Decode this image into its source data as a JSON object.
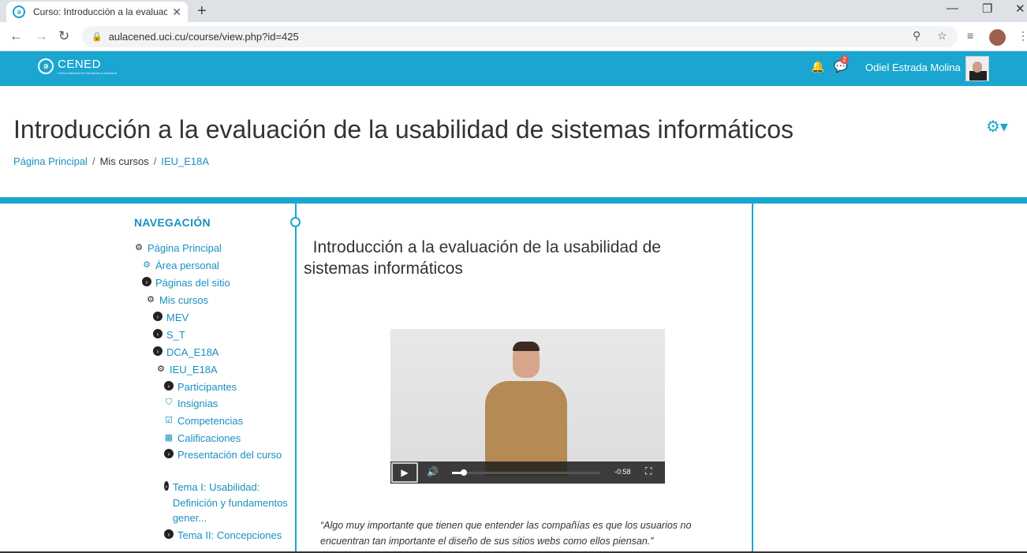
{
  "browser": {
    "tab_title": "Curso: Introducción a la evaluació",
    "url": "aulacened.uci.cu/course/view.php?id=425"
  },
  "header": {
    "logo_text": "CENED",
    "logo_sub": "Centro Nacional de Educación a Distancia",
    "notification_count": "2",
    "user_name": "Odiel Estrada Molina"
  },
  "page": {
    "title": "Introducción a la evaluación de la usabilidad de sistemas informáticos",
    "breadcrumb": [
      "Página Principal",
      "Mis cursos",
      "IEU_E18A"
    ]
  },
  "nav": {
    "heading": "NAVEGACIÓN",
    "items": [
      {
        "label": "Página Principal",
        "icon": "dashboard-icon"
      },
      {
        "label": "Área personal",
        "icon": "dashboard-icon"
      },
      {
        "label": "Páginas del sitio",
        "icon": "chevron-circle-icon"
      },
      {
        "label": "Mis cursos",
        "icon": "dashboard-icon"
      },
      {
        "label": "MEV",
        "icon": "chevron-circle-icon"
      },
      {
        "label": "S_T",
        "icon": "chevron-circle-icon"
      },
      {
        "label": "DCA_E18A",
        "icon": "chevron-circle-icon"
      },
      {
        "label": "IEU_E18A",
        "icon": "dashboard-icon"
      },
      {
        "label": "Participantes",
        "icon": "chevron-circle-icon"
      },
      {
        "label": "Insignias",
        "icon": "shield-icon"
      },
      {
        "label": "Competencias",
        "icon": "checkbox-icon"
      },
      {
        "label": "Calificaciones",
        "icon": "table-icon"
      },
      {
        "label": "Presentación del curso",
        "icon": "chevron-circle-icon"
      },
      {
        "label": "Tema I: Usabilidad: Definición y fundamentos gener...",
        "icon": "chevron-circle-icon"
      },
      {
        "label": "Tema II: Concepciones",
        "icon": "chevron-circle-icon"
      }
    ]
  },
  "content": {
    "title": "Introducción a la evaluación de la usabilidad de sistemas informáticos",
    "video_time": "-0:58",
    "quote": "“Algo muy importante que tienen que entender las compañías es que los usuarios no encuentran tan importante el diseño de sus sitios webs como ellos piensan.”"
  }
}
